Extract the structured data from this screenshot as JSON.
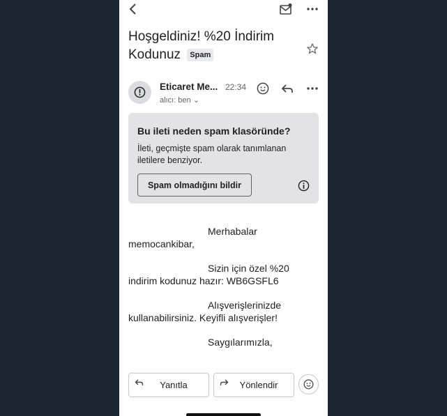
{
  "email": {
    "subject": "Hoşgeldiniz! %20 İndirim Kodunuz",
    "spam_badge": "Spam",
    "sender_name": "Eticaret Me...",
    "time": "22:34",
    "recipient": "alıcı: ben ⌄"
  },
  "spam_notice": {
    "title": "Bu ileti neden spam klasöründe?",
    "description": "İleti, geçmişte spam olarak tanımlanan iletilere benziyor.",
    "button_label": "Spam olmadığını bildir"
  },
  "body": {
    "p1_first": "Merhabalar",
    "p1_rest": "memocankibar,",
    "p2_first": "Sizin için özel %20",
    "p2_rest": "indirim kodunuz hazır: WB6GSFL6",
    "p3_first": "Alışverişlerinizde",
    "p3_rest": "kullanabilirsiniz. Keyifli alışverişler!",
    "p4_first": "Saygılarımızla,"
  },
  "actions": {
    "reply_label": "Yanıtla",
    "forward_label": "Yönlendir"
  },
  "icons": {
    "back": "chevron-left-icon",
    "mark_unread": "mail-unread-icon",
    "more": "more-vert-icon",
    "star": "star-outline-icon",
    "alert": "alert-circle-icon",
    "emoji": "emoji-icon",
    "reply": "reply-icon",
    "info": "info-icon",
    "forward": "forward-icon"
  },
  "colors": {
    "background": "#1c2530",
    "spam_box": "#e3e3e6",
    "text": "#202124"
  }
}
